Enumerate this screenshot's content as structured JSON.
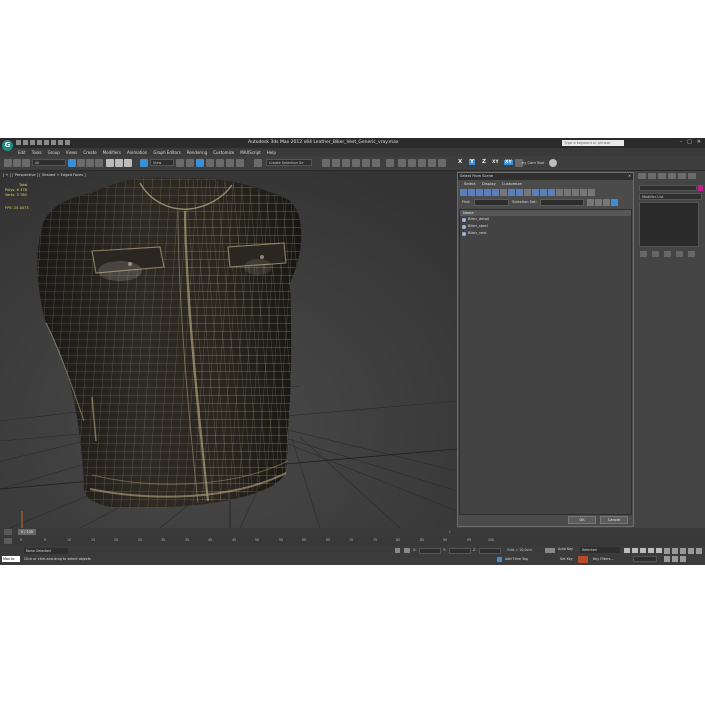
{
  "app": {
    "icon_letter": "G",
    "title": "Autodesk 3ds Max  2012 x64    Leather_Biker_Vest_Generic_vray.max",
    "search_placeholder": "Type a keyword or phrase",
    "window_buttons": [
      "–",
      "□",
      "✕"
    ]
  },
  "menu": [
    "Edit",
    "Tools",
    "Group",
    "Views",
    "Create",
    "Modifiers",
    "Animation",
    "Graph Editors",
    "Rendering",
    "Customize",
    "MAXScript",
    "Help"
  ],
  "toolbar": {
    "filter": "All",
    "reference_coord": "View",
    "named_selection": "Create Selection Se",
    "axes": [
      "X",
      "Y",
      "Z",
      "XY"
    ],
    "axis_active": "Y",
    "constraint_active": "XY",
    "tool_label": "ey Cam Tool ."
  },
  "viewport": {
    "label": "[ + ] [ Perspective ] [ Shaded + Edged Faces ]",
    "stats": {
      "total_label": "Total",
      "polys_label": "Polys:",
      "polys_value": "6 376",
      "verts_label": "Verts:",
      "verts_value": "3 780",
      "fps_label": "FPS:",
      "fps_value": "25.0075"
    }
  },
  "dialog": {
    "title": "Select From Scene",
    "close": "✕",
    "menu": [
      "Select",
      "Display",
      "Customize"
    ],
    "find_label": "Find:",
    "selection_set_label": "Selection Set:",
    "column_header": "Name",
    "objects": [
      "Biker_detail",
      "Biker_steel",
      "Biker_vest"
    ],
    "ok": "OK",
    "cancel": "Cancel"
  },
  "command_panel": {
    "modifier_list": "Modifier List",
    "swatch_color": "#c01f8c"
  },
  "timeline": {
    "frame_slider": "0 / 100",
    "ticks": [
      "0",
      "5",
      "10",
      "15",
      "20",
      "25",
      "30",
      "35",
      "40",
      "45",
      "50",
      "55",
      "60",
      "65",
      "70",
      "75",
      "80",
      "85",
      "90",
      "95",
      "100"
    ]
  },
  "status": {
    "selection": "None Selected",
    "prompt": "Click or click-and-drag to select objects",
    "maxscript_mini": "Max to",
    "x_label": "X:",
    "y_label": "Y:",
    "z_label": "Z:",
    "grid": "Grid = 10,0cm",
    "auto_key": "Auto Key",
    "set_key": "Set Key",
    "key_filters": "Key Filters...",
    "selected": "Selected",
    "add_time_tag": "Add Time Tag"
  },
  "colors": {
    "accent": "#3b8fd6",
    "stats_text": "#e6d65c",
    "viewport_bg": "#3f3f3f",
    "vest_leather": "#2b2722",
    "vest_wire": "#b9a982"
  }
}
